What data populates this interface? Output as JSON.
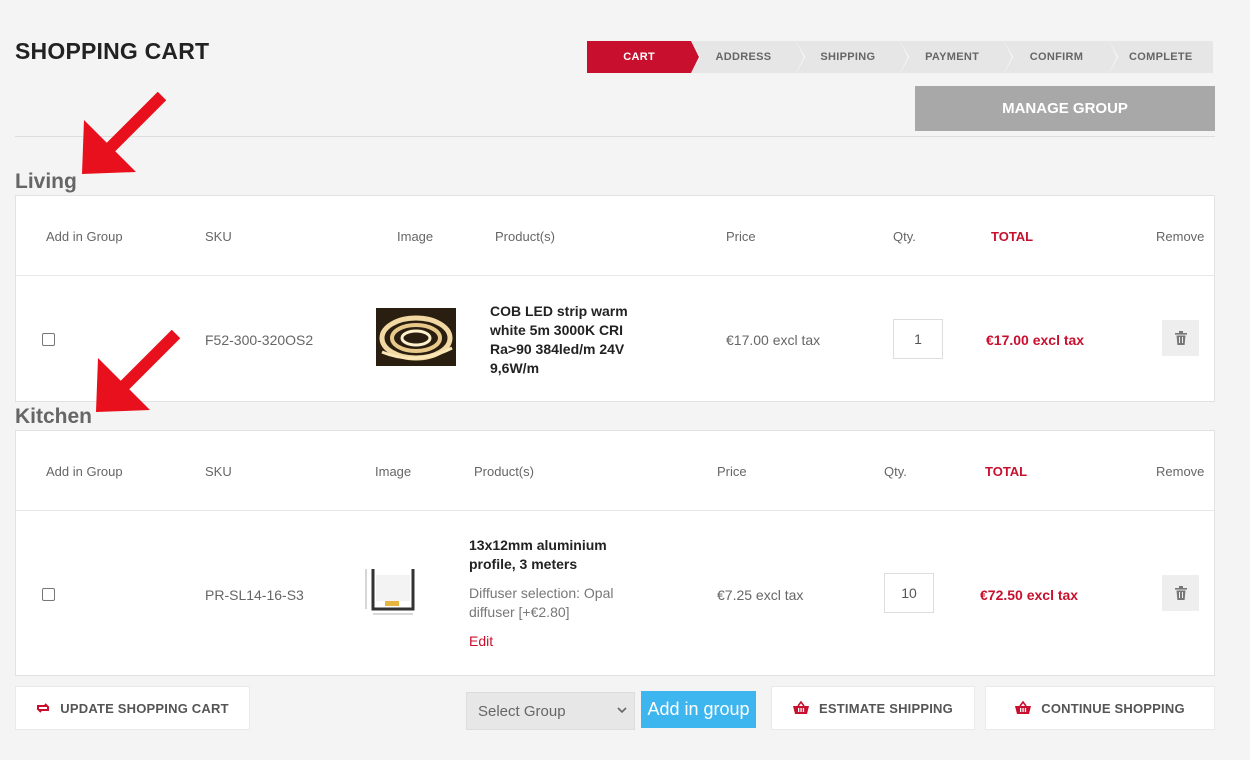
{
  "page": {
    "title": "SHOPPING CART"
  },
  "steps": [
    "CART",
    "ADDRESS",
    "SHIPPING",
    "PAYMENT",
    "CONFIRM",
    "COMPLETE"
  ],
  "manage_group_label": "MANAGE GROUP",
  "columns": {
    "add_in_group": "Add in Group",
    "sku": "SKU",
    "image": "Image",
    "products": "Product(s)",
    "price": "Price",
    "qty": "Qty.",
    "total": "TOTAL",
    "remove": "Remove"
  },
  "groups": [
    {
      "name": "Living",
      "item": {
        "sku": "F52-300-320OS2",
        "product_lines": [
          "COB LED strip warm",
          "white 5m 3000K CRI",
          "Ra>90 384led/m 24V",
          "9,6W/m"
        ],
        "price": "€17.00 excl tax",
        "qty": "1",
        "total": "€17.00 excl tax",
        "image_icon": "led-strip-thumbnail"
      }
    },
    {
      "name": "Kitchen",
      "item": {
        "sku": "PR-SL14-16-S3",
        "product_lines": [
          "13x12mm aluminium",
          "profile, 3 meters"
        ],
        "attribute_lines": [
          "Diffuser selection: Opal",
          "diffuser [+€2.80]"
        ],
        "edit_label": "Edit",
        "price": "€7.25 excl tax",
        "qty": "10",
        "total": "€72.50 excl tax",
        "image_icon": "aluminium-profile-thumbnail"
      }
    }
  ],
  "footer": {
    "update_cart": "UPDATE SHOPPING CART",
    "select_group_placeholder": "Select Group",
    "add_in_group": "Add in group",
    "estimate_shipping": "ESTIMATE SHIPPING",
    "continue_shopping": "CONTINUE SHOPPING"
  },
  "colors": {
    "accent": "#c8102e",
    "blue": "#3db5ee",
    "annotation_arrow": "#e8101c"
  }
}
